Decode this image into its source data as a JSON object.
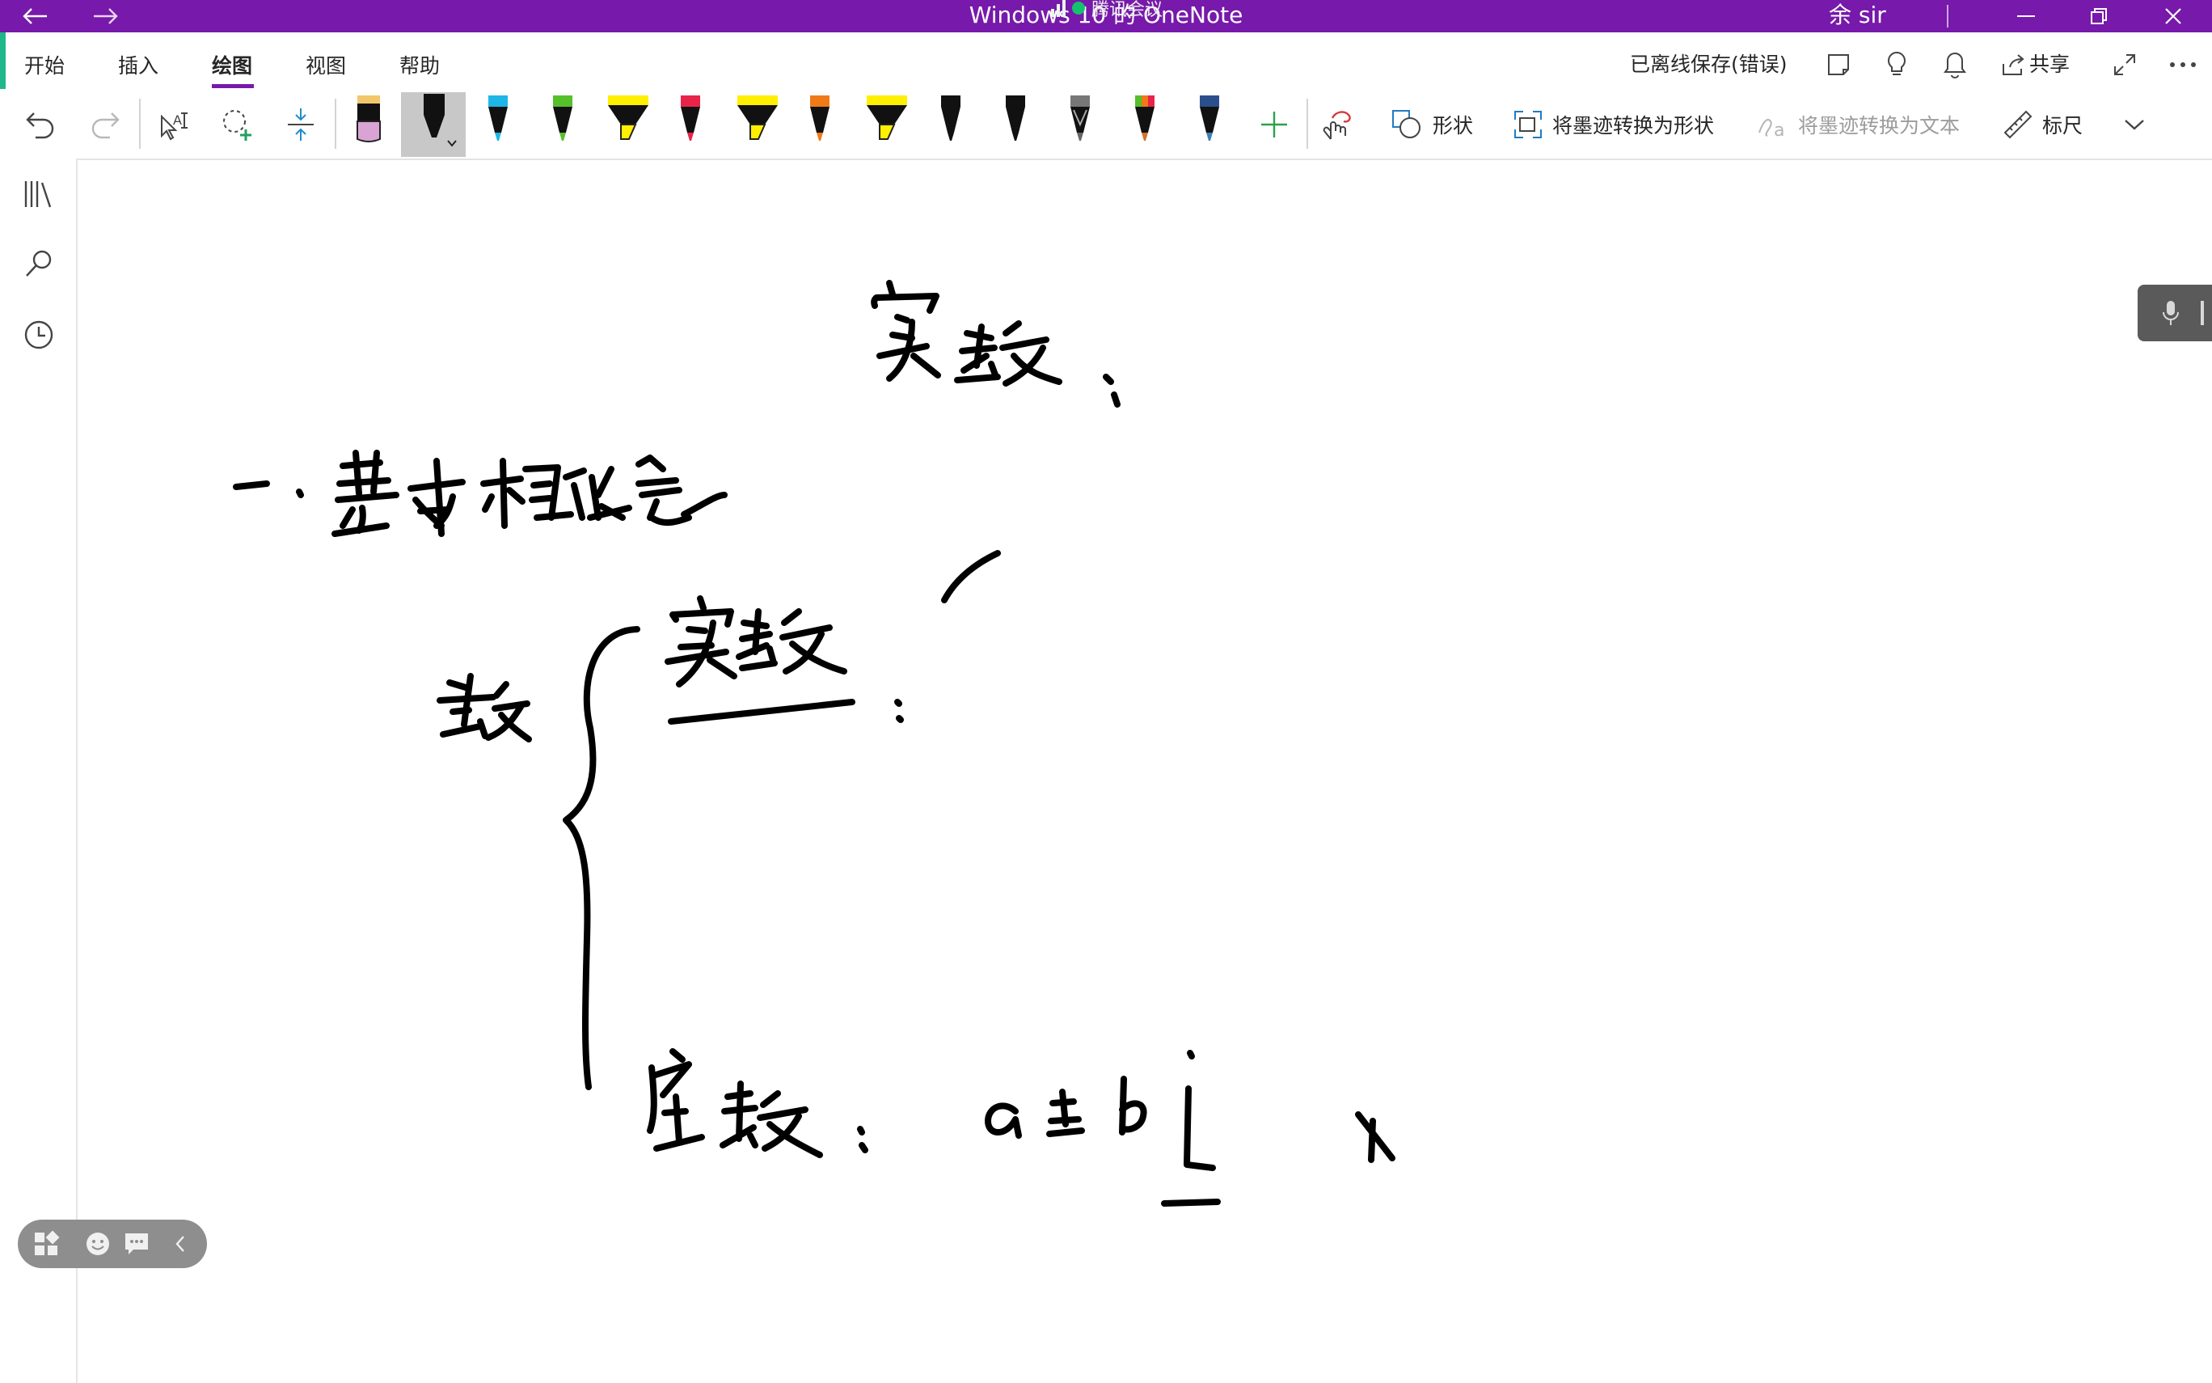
{
  "titlebar": {
    "title": "Windows 10 的 OneNote",
    "overlay_text": "腾讯会议",
    "user": "余 sir",
    "back_icon": "arrow-left-icon",
    "forward_icon": "arrow-right-icon",
    "bg_color": "#7719aa"
  },
  "ribbon": {
    "tabs": [
      {
        "label": "开始",
        "active": false
      },
      {
        "label": "插入",
        "active": false
      },
      {
        "label": "绘图",
        "active": true
      },
      {
        "label": "视图",
        "active": false
      },
      {
        "label": "帮助",
        "active": false
      }
    ],
    "save_status": "已离线保存(错误)",
    "share_label": "共享"
  },
  "draw_toolbar": {
    "shapes_label": "形状",
    "ink_to_shape_label": "将墨迹转换为形状",
    "ink_to_text_label": "将墨迹转换为文本",
    "ruler_label": "标尺",
    "pens": [
      {
        "name": "pink-highlighter",
        "color": "#d9a4d4"
      },
      {
        "name": "black-pen-selected",
        "color": "#000000"
      },
      {
        "name": "cyan-pen",
        "color": "#1fb6e6"
      },
      {
        "name": "green-pen",
        "color": "#55c02a"
      },
      {
        "name": "yellow-highlighter",
        "color": "#ffef00"
      },
      {
        "name": "red-pen",
        "color": "#e8244a"
      },
      {
        "name": "yellow-highlighter-2",
        "color": "#ffef00"
      },
      {
        "name": "orange-pen",
        "color": "#f07a18"
      },
      {
        "name": "yellow-highlighter-3",
        "color": "#ffef00"
      },
      {
        "name": "black-pen-2",
        "color": "#111111"
      },
      {
        "name": "black-pen-3",
        "color": "#111111"
      },
      {
        "name": "galaxy-pen",
        "color": "#6b6b6b"
      },
      {
        "name": "rainbow-pen",
        "color": "#d7702c"
      },
      {
        "name": "ocean-pen",
        "color": "#2a4f8c"
      }
    ]
  },
  "accent": "#7719aa"
}
